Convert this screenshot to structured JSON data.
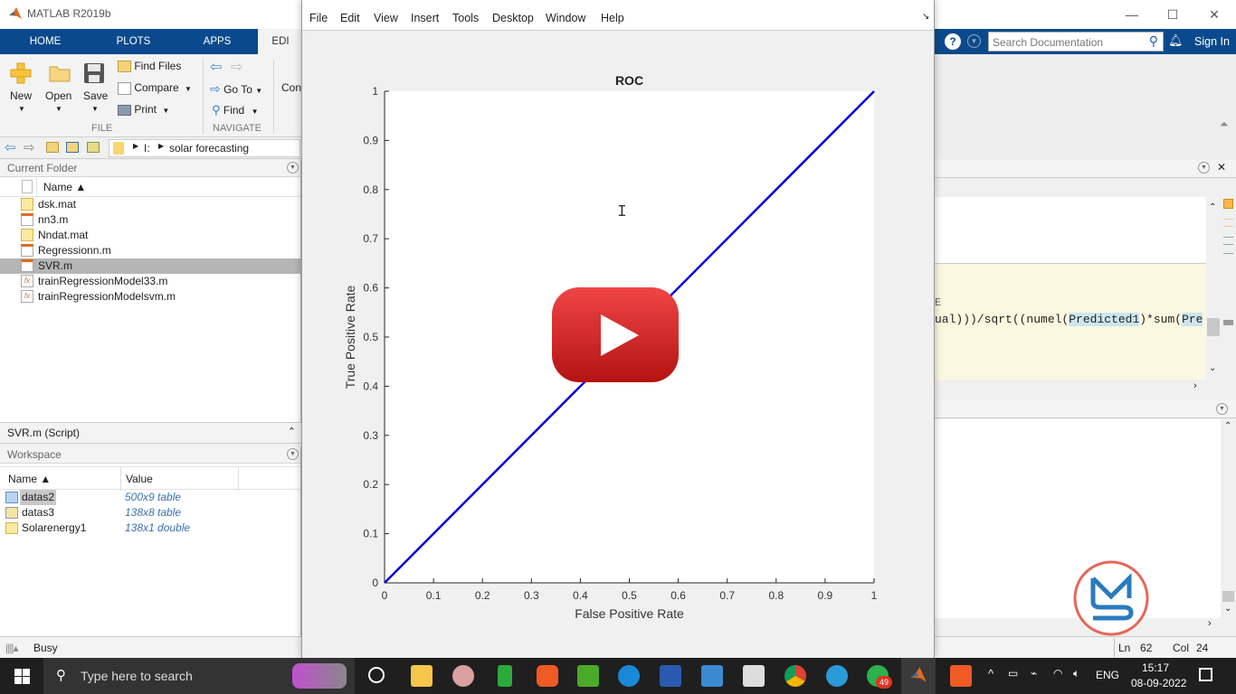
{
  "app": {
    "title": "MATLAB R2019b",
    "window_controls": {
      "minimize": "—",
      "maximize": "☐",
      "close": "✕"
    }
  },
  "ribbon": {
    "tabs": [
      {
        "label": "HOME"
      },
      {
        "label": "PLOTS"
      },
      {
        "label": "APPS"
      },
      {
        "label": "EDI"
      }
    ],
    "file_section": {
      "label": "FILE",
      "new": "New",
      "open": "Open",
      "save": "Save",
      "find_files": "Find Files",
      "compare": "Compare",
      "print": "Print"
    },
    "navigate_section": {
      "label": "NAVIGATE",
      "go_to": "Go To",
      "find": "Find"
    },
    "partial_label": "Con",
    "search_placeholder": "Search Documentation",
    "sign_in": "Sign In"
  },
  "address": {
    "path": [
      "I:",
      "solar forecasting"
    ]
  },
  "current_folder": {
    "title": "Current Folder",
    "column_name": "Name ▲",
    "files": [
      {
        "name": "dsk.mat",
        "type": "mat"
      },
      {
        "name": "nn3.m",
        "type": "script"
      },
      {
        "name": "Nndat.mat",
        "type": "mat"
      },
      {
        "name": "Regressionn.m",
        "type": "script"
      },
      {
        "name": "SVR.m",
        "type": "script",
        "selected": true
      },
      {
        "name": "trainRegressionModel33.m",
        "type": "function"
      },
      {
        "name": "trainRegressionModelsvm.m",
        "type": "function"
      }
    ]
  },
  "details_bar": {
    "label": "SVR.m  (Script)"
  },
  "workspace": {
    "title": "Workspace",
    "columns": [
      "Name ▲",
      "Value"
    ],
    "variables": [
      {
        "name": "datas2",
        "value": "500x9 table",
        "selected": true
      },
      {
        "name": "datas3",
        "value": "138x8 table"
      },
      {
        "name": "Solarenergy1",
        "value": "138x1 double"
      }
    ]
  },
  "status": {
    "text": "Busy",
    "ln_label": "Ln",
    "ln": "62",
    "col_label": "Col",
    "col": "24"
  },
  "editor": {
    "code_partial_top": "E",
    "code_line_parts": [
      {
        "text": "ual)))/sqrt((numel(",
        "hl": false
      },
      {
        "text": "Predicted1",
        "hl": true
      },
      {
        "text": ")*sum(",
        "hl": false
      },
      {
        "text": "Pre",
        "hl": true
      }
    ]
  },
  "figure": {
    "menus": [
      "File",
      "Edit",
      "View",
      "Insert",
      "Tools",
      "Desktop",
      "Window",
      "Help"
    ]
  },
  "chart_data": {
    "type": "line",
    "title": "ROC",
    "xlabel": "False Positive Rate",
    "ylabel": "True Positive Rate",
    "xlim": [
      0,
      1
    ],
    "ylim": [
      0,
      1
    ],
    "xticks": [
      "0",
      "0.1",
      "0.2",
      "0.3",
      "0.4",
      "0.5",
      "0.6",
      "0.7",
      "0.8",
      "0.9",
      "1"
    ],
    "yticks": [
      "0",
      "0.1",
      "0.2",
      "0.3",
      "0.4",
      "0.5",
      "0.6",
      "0.7",
      "0.8",
      "0.9",
      "1"
    ],
    "grid": false,
    "series": [
      {
        "name": "ROC",
        "color": "#0000e0",
        "x": [
          0,
          1
        ],
        "y": [
          0,
          1
        ]
      }
    ]
  },
  "overlay": {
    "play_button_color": "#d42323",
    "watermark_color": "#2a7bbf",
    "watermark_ring": "#e4685a"
  },
  "taskbar": {
    "search_placeholder": "Type here to search",
    "whatsapp_badge": "49",
    "language": "ENG",
    "time": "15:17",
    "date": "08-09-2022"
  }
}
